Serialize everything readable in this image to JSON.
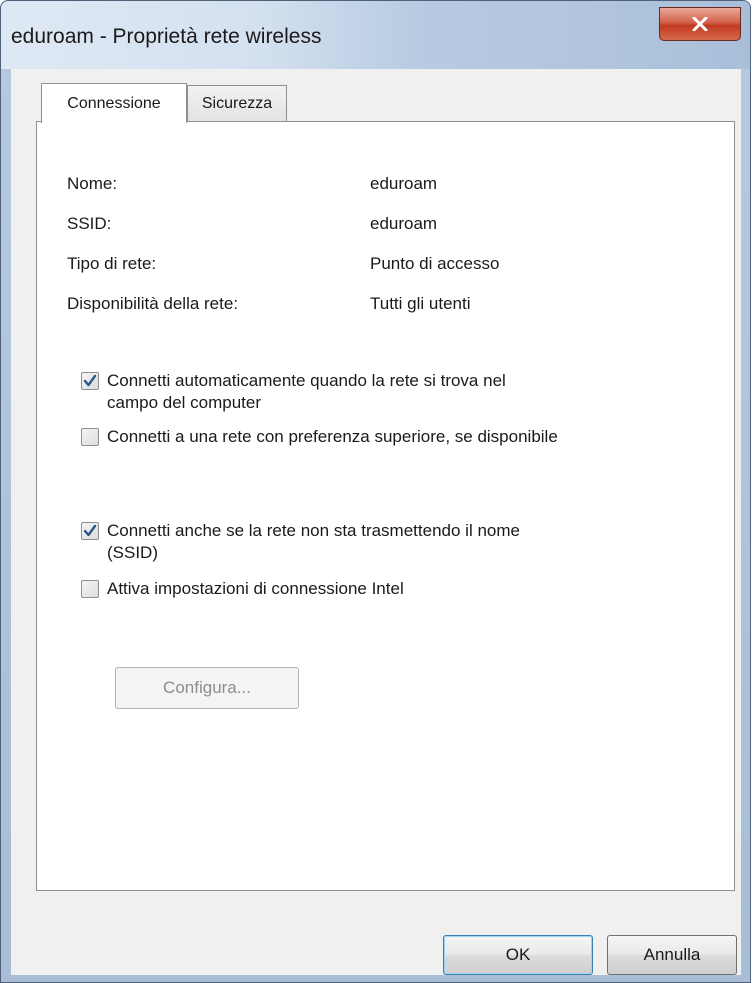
{
  "window": {
    "title": "eduroam - Proprietà rete wireless",
    "close_icon": "close-icon"
  },
  "tabs": [
    {
      "label": "Connessione",
      "selected": true
    },
    {
      "label": "Sicurezza",
      "selected": false
    }
  ],
  "properties": [
    {
      "label": "Nome:",
      "value": "eduroam"
    },
    {
      "label": "SSID:",
      "value": "eduroam"
    },
    {
      "label": "Tipo di rete:",
      "value": "Punto di accesso"
    },
    {
      "label": "Disponibilità della rete:",
      "value": "Tutti gli utenti"
    }
  ],
  "checkboxes": [
    {
      "line1": "Connetti automaticamente quando la rete si trova nel",
      "line2": "campo del computer",
      "checked": true
    },
    {
      "line1": "Connetti a una rete con preferenza superiore, se disponibile",
      "line2": "",
      "checked": false
    },
    {
      "line1": "Connetti anche se la rete non sta trasmettendo il nome",
      "line2": "(SSID)",
      "checked": true
    },
    {
      "line1": "Attiva impostazioni di connessione Intel",
      "line2": "",
      "checked": false
    }
  ],
  "configure_button": {
    "label": "Configura...",
    "enabled": false
  },
  "footer": {
    "ok_label": "OK",
    "cancel_label": "Annulla"
  },
  "colors": {
    "accent": "#3c7fb1",
    "close_button": "#c03a22",
    "checkmark": "#2a5a8c"
  }
}
